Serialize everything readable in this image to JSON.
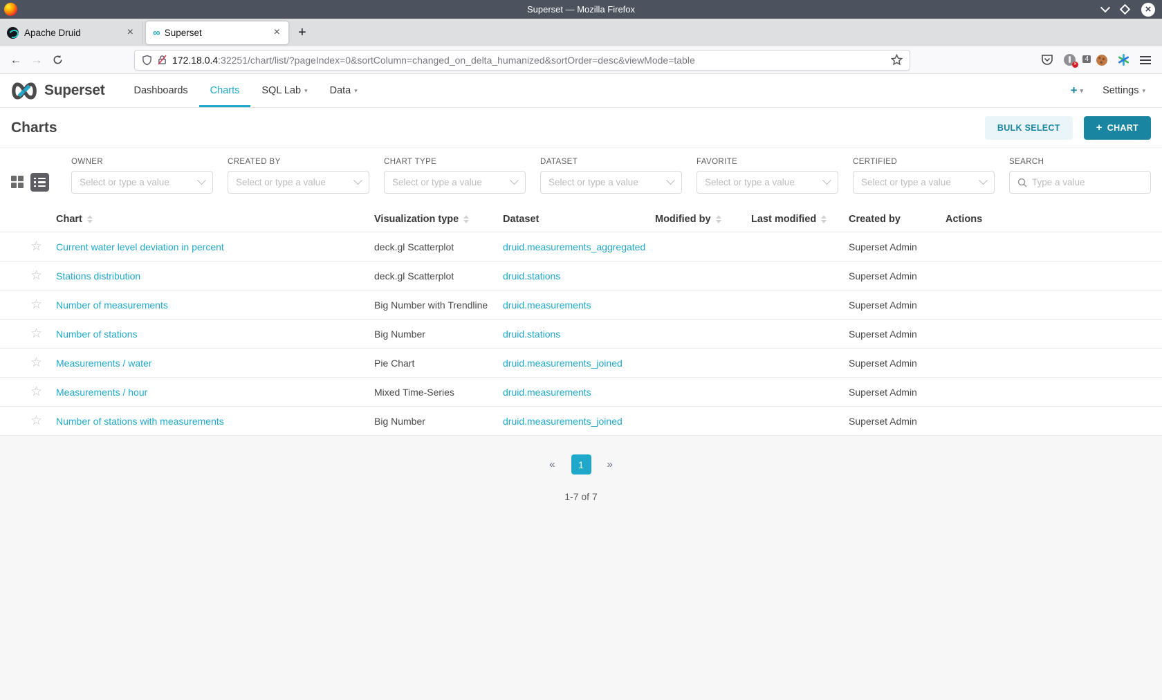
{
  "window": {
    "title": "Superset — Mozilla Firefox"
  },
  "browser": {
    "tabs": [
      {
        "label": "Apache Druid"
      },
      {
        "label": "Superset"
      }
    ],
    "url": {
      "host": "172.18.0.4",
      "rest": ":32251/chart/list/?pageIndex=0&sortColumn=changed_on_delta_humanized&sortOrder=desc&viewMode=table"
    },
    "extension_badge": "4"
  },
  "icons": {
    "close": "×",
    "plus": "+",
    "caret": "▾",
    "star": "☆",
    "back": "←",
    "forward": "→",
    "infinity": "∞",
    "prev": "«",
    "next": "»"
  },
  "navbar": {
    "brand": "Superset",
    "items": [
      {
        "label": "Dashboards"
      },
      {
        "label": "Charts"
      },
      {
        "label": "SQL Lab"
      },
      {
        "label": "Data"
      }
    ],
    "settings": "Settings"
  },
  "page": {
    "title": "Charts",
    "bulk_select": "BULK SELECT",
    "new_chart": "CHART"
  },
  "filters": [
    {
      "label": "OWNER",
      "placeholder": "Select or type a value"
    },
    {
      "label": "CREATED BY",
      "placeholder": "Select or type a value"
    },
    {
      "label": "CHART TYPE",
      "placeholder": "Select or type a value"
    },
    {
      "label": "DATASET",
      "placeholder": "Select or type a value"
    },
    {
      "label": "FAVORITE",
      "placeholder": "Select or type a value"
    },
    {
      "label": "CERTIFIED",
      "placeholder": "Select or type a value"
    },
    {
      "label": "SEARCH",
      "placeholder": "Type a value"
    }
  ],
  "table": {
    "columns": [
      {
        "label": "Chart"
      },
      {
        "label": "Visualization type"
      },
      {
        "label": "Dataset"
      },
      {
        "label": "Modified by"
      },
      {
        "label": "Last modified"
      },
      {
        "label": "Created by"
      },
      {
        "label": "Actions"
      }
    ],
    "rows": [
      {
        "chart": "Current water level deviation in percent",
        "viz": "deck.gl Scatterplot",
        "dataset": "druid.measurements_aggregated",
        "modified_by": "",
        "last_modified": "",
        "created_by": "Superset Admin"
      },
      {
        "chart": "Stations distribution",
        "viz": "deck.gl Scatterplot",
        "dataset": "druid.stations",
        "modified_by": "",
        "last_modified": "",
        "created_by": "Superset Admin"
      },
      {
        "chart": "Number of measurements",
        "viz": "Big Number with Trendline",
        "dataset": "druid.measurements",
        "modified_by": "",
        "last_modified": "",
        "created_by": "Superset Admin"
      },
      {
        "chart": "Number of stations",
        "viz": "Big Number",
        "dataset": "druid.stations",
        "modified_by": "",
        "last_modified": "",
        "created_by": "Superset Admin"
      },
      {
        "chart": "Measurements / water",
        "viz": "Pie Chart",
        "dataset": "druid.measurements_joined",
        "modified_by": "",
        "last_modified": "",
        "created_by": "Superset Admin"
      },
      {
        "chart": "Measurements / hour",
        "viz": "Mixed Time-Series",
        "dataset": "druid.measurements",
        "modified_by": "",
        "last_modified": "",
        "created_by": "Superset Admin"
      },
      {
        "chart": "Number of stations with measurements",
        "viz": "Big Number",
        "dataset": "druid.measurements_joined",
        "modified_by": "",
        "last_modified": "",
        "created_by": "Superset Admin"
      }
    ]
  },
  "pagination": {
    "page": "1",
    "summary": "1-7 of 7"
  },
  "colors": {
    "primary": "#20A7C9",
    "primary_dark": "#1A85A0",
    "primary_light": "#E9F5F9",
    "titlebar": "#4C535F"
  }
}
